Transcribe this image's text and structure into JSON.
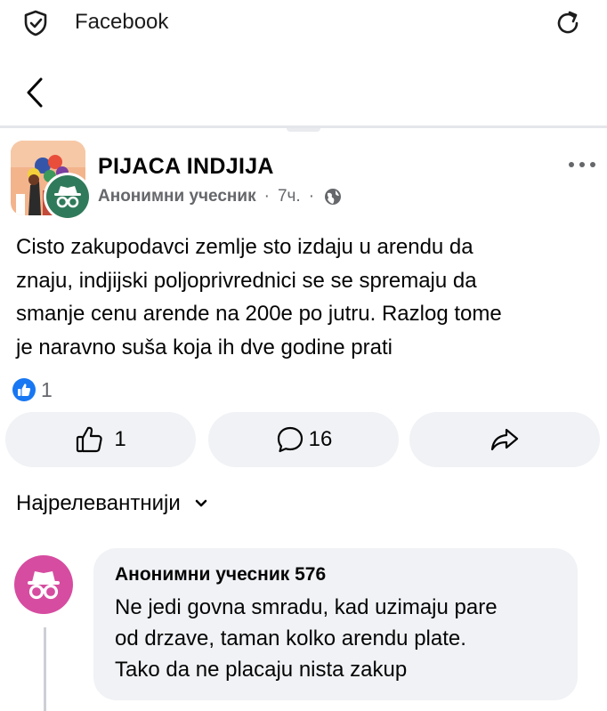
{
  "browser": {
    "title": "Facebook",
    "icons": [
      "shield-icon",
      "reload-icon"
    ]
  },
  "nav": {
    "back_icon": "back-arrow-icon"
  },
  "post": {
    "group_name": "PIJACA INDJIJA",
    "author": "Анонимни учесник",
    "time": "7ч.",
    "separator": "·",
    "privacy_icon": "globe-icon",
    "lines": [
      "Cisto zakupodavci zemlje sto izdaju u arendu da",
      "znaju, indjijski poljoprivrednici se se spremaju da",
      "smanje cenu arende na 200e po jutru. Razlog tome",
      "je naravno suša koja ih dve godine prati"
    ],
    "reaction_count": "1",
    "actions": {
      "like_count": "1",
      "comment_count": "16"
    },
    "colors": {
      "like_blue": "#1877f2",
      "anon_green": "#2f7a5a",
      "anon_pink": "#d64ca0",
      "button_bg": "#f0f2f5",
      "secondary_text": "#65676b"
    }
  },
  "comments": {
    "sort_label": "Најрелевантнији",
    "items": [
      {
        "author": "Анонимни учесник 576",
        "lines": [
          "Ne jedi govna smradu, kad uzimaju pare",
          "od drzave, taman kolko arendu plate.",
          "Tako da ne placaju nista zakup"
        ]
      }
    ]
  }
}
